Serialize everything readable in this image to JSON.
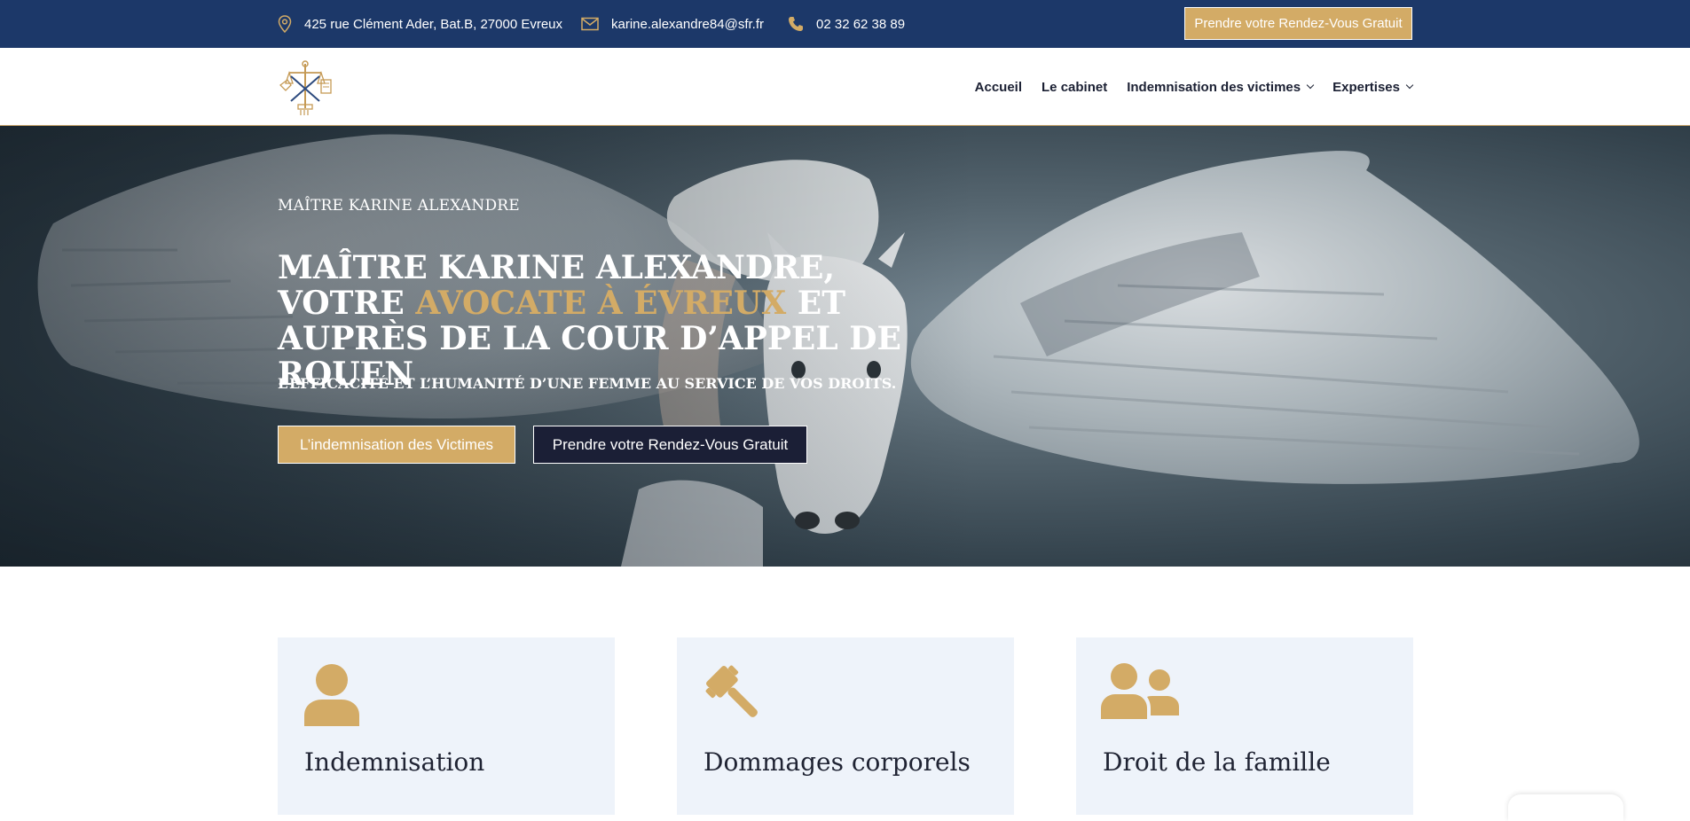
{
  "topbar": {
    "address": "425 rue Clément Ader, Bat.B, 27000 Evreux",
    "email": "karine.alexandre84@sfr.fr",
    "phone": "02 32 62 38 89",
    "cta_label": "Prendre votre Rendez-Vous Gratuit",
    "icons": [
      "map-pin-icon",
      "envelope-icon",
      "phone-icon"
    ],
    "accent": "#d3ab66",
    "background": "#1c3869"
  },
  "nav": {
    "items": [
      {
        "label": "Accueil"
      },
      {
        "label": "Le cabinet"
      },
      {
        "label": "Indemnisation des victimes"
      },
      {
        "label": "Expertises"
      }
    ]
  },
  "hero": {
    "eyebrow": "MAÎTRE KARINE ALEXANDRE",
    "title_part1": "MAÎTRE KARINE ALEXANDRE, VOTRE ",
    "title_highlight": "AVOCATE À ÉVREUX",
    "title_part2": " ET AUPRÈS DE LA COUR D’APPEL DE ROUEN",
    "subtitle": "L’EFFICACITÉ ET L’HUMANITÉ D’UNE FEMME AU SERVICE DE VOS DROITS.",
    "button_primary": "L’indemnisation des Victimes",
    "button_secondary": "Prendre votre Rendez-Vous Gratuit"
  },
  "cards": [
    {
      "title": "Indemnisation",
      "icon": "person-icon"
    },
    {
      "title": "Dommages corporels",
      "icon": "gavel-icon"
    },
    {
      "title": "Droit de la famille",
      "icon": "users-icon"
    }
  ]
}
